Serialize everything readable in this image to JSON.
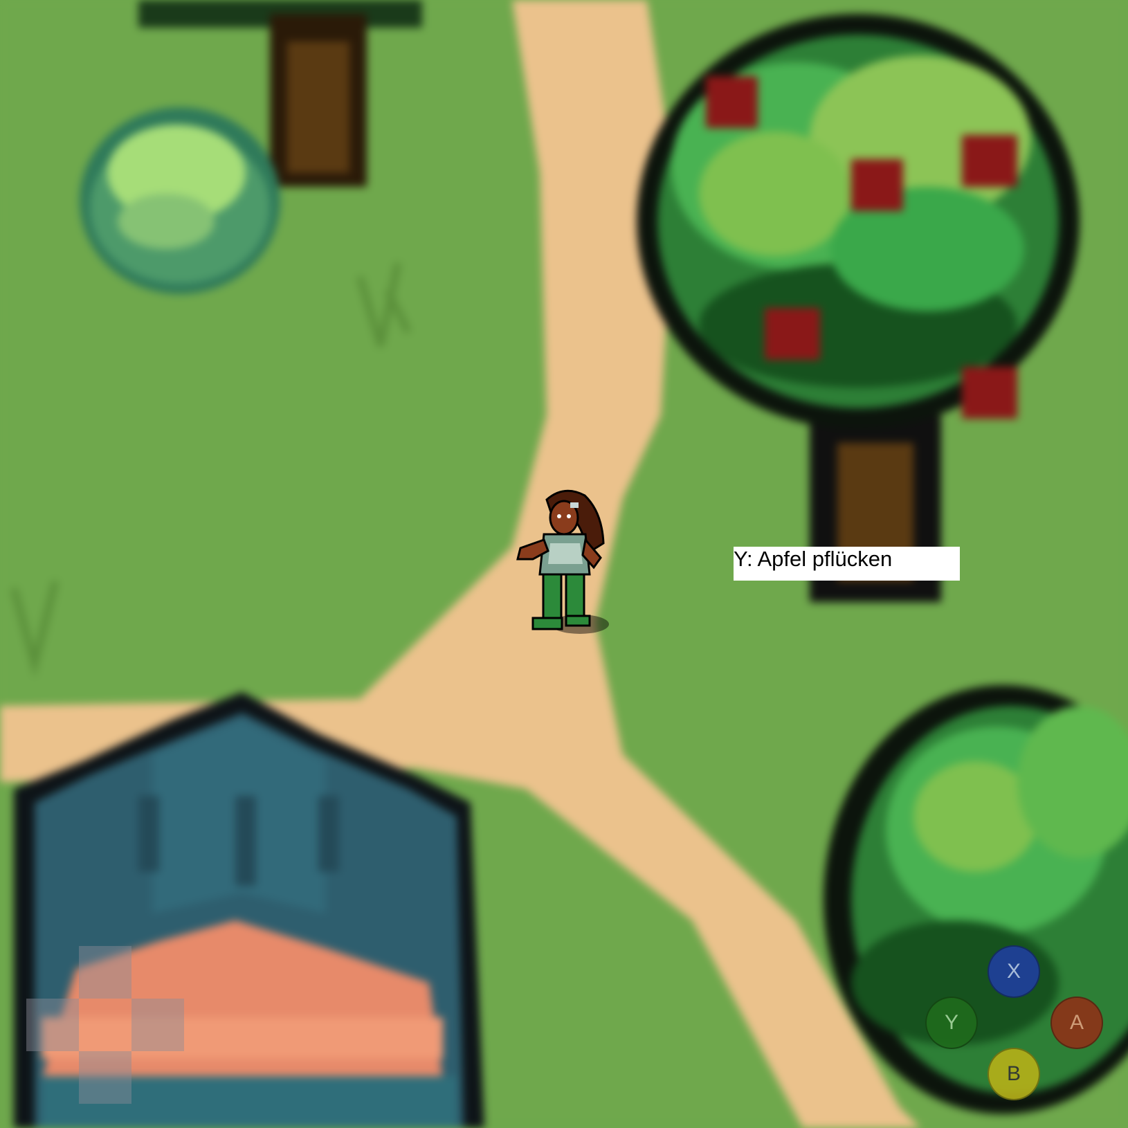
{
  "hud": {
    "interaction_prompt": "Y: Apfel pflücken"
  },
  "controls": {
    "face_buttons": {
      "x": "X",
      "y": "Y",
      "a": "A",
      "b": "B"
    },
    "colors": {
      "x": "#1f3f9e",
      "y": "#1f6b1c",
      "a": "#8e3218",
      "b": "#b6b019"
    }
  },
  "scene": {
    "icons": [
      "apple-tree-icon",
      "bush-icon",
      "tree-icon",
      "house-roof-icon",
      "player-character-icon",
      "grass-tuft-icon"
    ]
  }
}
